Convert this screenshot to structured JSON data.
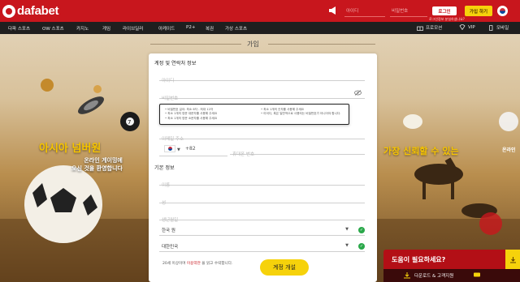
{
  "header": {
    "brand": "dafabet",
    "username_placeholder": "아이디",
    "password_placeholder": "비밀번호",
    "login_label": "로그인",
    "forgot_label": "로그인정보 분실하셨나요?",
    "join_label": "가입 하기"
  },
  "nav": {
    "items": [
      "다파 스포츠",
      "OW 스포츠",
      "카지노",
      "게임",
      "라이브딜러",
      "아케이드",
      "P2+",
      "복권",
      "가상 스포츠"
    ],
    "right": {
      "promo": "프로모션",
      "vip": "VIP",
      "mobile": "모바일"
    }
  },
  "banner": {
    "left_title": "아시아 넘버원",
    "left_sub_1": "온라인 게이밍에",
    "left_sub_2": "오신 것을 환영합니다",
    "right_title": "가장 신뢰할 수 있는",
    "right_edge": "온라인"
  },
  "page": {
    "title": "가입"
  },
  "form": {
    "section_account": "계정 및 연락처 정보",
    "username_placeholder": "아이디",
    "password_placeholder": "비밀번호",
    "password_rules_left": [
      "비밀번호 길이: 최소 6자 - 최대 12자",
      "최소 1개의 영문 대문자를 사용해 주세요",
      "최소 1개의 영문 소문자를 사용해 주세요"
    ],
    "password_rules_right": [
      "최소 1개의 숫자를 사용해 주세요",
      "아이디, 혹은 일반적으로 사용되는 비밀번호가 아니어야 합니다."
    ],
    "email_placeholder": "이메일 주소",
    "phone_code": "+82",
    "phone_placeholder": "휴대폰 번호",
    "section_basic": "기본 정보",
    "name_placeholder": "이름",
    "surname_placeholder": "성",
    "dob_placeholder": "생년월일",
    "currency_value": "한국 원",
    "country_value": "대한민국",
    "terms_prefix": "20세 이상이며 ",
    "terms_link": "이용약관",
    "terms_suffix": " 을 읽고 수락합니다.",
    "submit_label": "계정 개설"
  },
  "help": {
    "title": "도움이 필요하세요?",
    "sub": "다운로드 & 고객지원"
  },
  "colors": {
    "brand_red": "#c8161d",
    "accent_yellow": "#f6d20b",
    "nav_dark": "#1f1f1f",
    "check_green": "#2aa84a"
  }
}
